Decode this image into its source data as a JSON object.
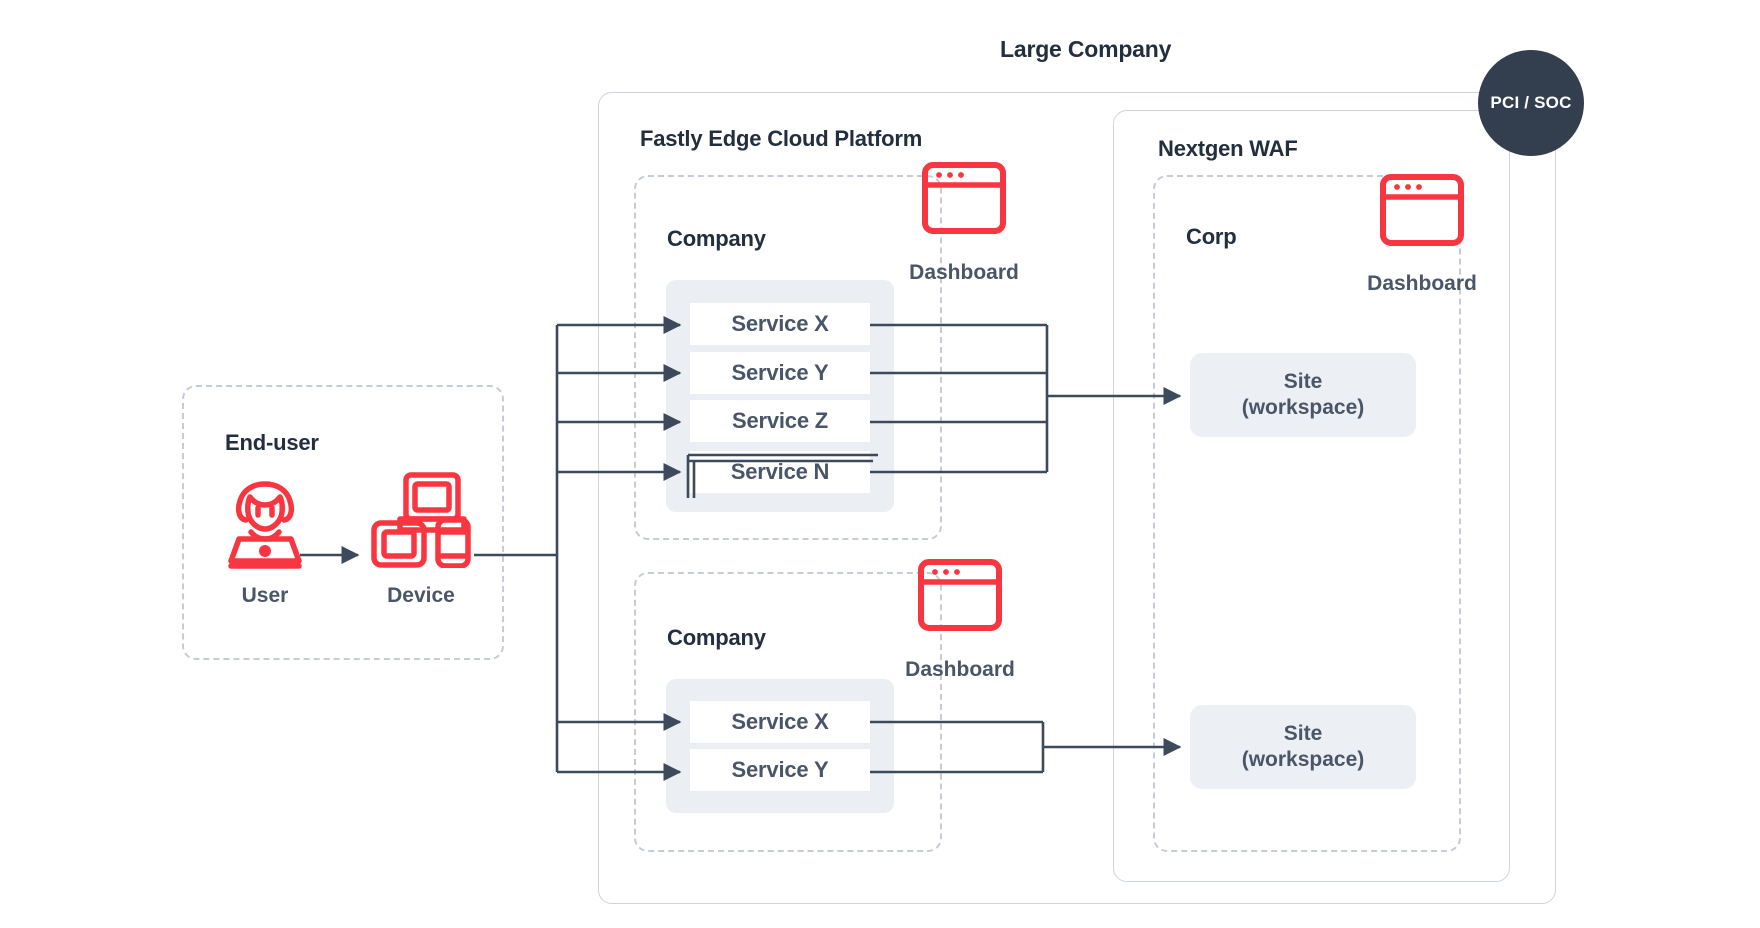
{
  "diagram": {
    "title": "Large Company",
    "badge": {
      "label": "PCI / SOC",
      "color": "#333f4e"
    },
    "accent_red": "#f73641",
    "line_color": "#3d4a5c",
    "panel_bg": "#ebeff3"
  },
  "enduser": {
    "title": "End-user",
    "nodes": [
      {
        "icon": "user-at-laptop-icon",
        "label": "User"
      },
      {
        "icon": "devices-icon",
        "label": "Device"
      }
    ]
  },
  "fastly": {
    "title": "Fastly Edge Cloud Platform",
    "groups": [
      {
        "title": "Company",
        "dashboard_label": "Dashboard",
        "dashboard_icon": "browser-window-icon",
        "services": [
          "Service X",
          "Service Y",
          "Service Z",
          "Service N"
        ]
      },
      {
        "title": "Company",
        "dashboard_label": "Dashboard",
        "dashboard_icon": "browser-window-icon",
        "services": [
          "Service X",
          "Service Y"
        ]
      }
    ]
  },
  "waf": {
    "title": "Nextgen WAF",
    "group": {
      "title": "Corp",
      "dashboard_label": "Dashboard",
      "dashboard_icon": "browser-window-icon"
    },
    "sites": [
      {
        "line1": "Site",
        "line2": "(workspace)"
      },
      {
        "line1": "Site",
        "line2": "(workspace)"
      }
    ]
  }
}
